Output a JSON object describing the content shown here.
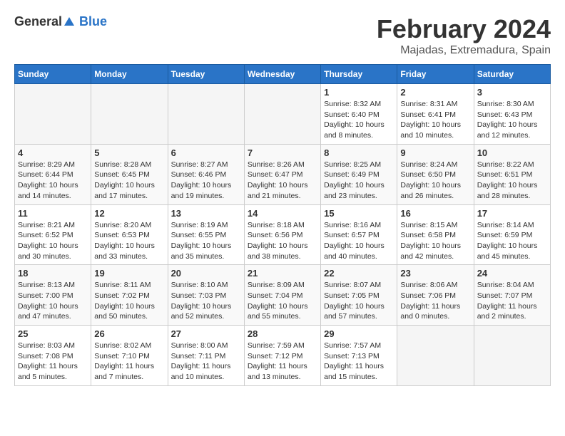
{
  "logo": {
    "general": "General",
    "blue": "Blue"
  },
  "title": {
    "month": "February 2024",
    "location": "Majadas, Extremadura, Spain"
  },
  "headers": [
    "Sunday",
    "Monday",
    "Tuesday",
    "Wednesday",
    "Thursday",
    "Friday",
    "Saturday"
  ],
  "weeks": [
    [
      {
        "day": "",
        "info": ""
      },
      {
        "day": "",
        "info": ""
      },
      {
        "day": "",
        "info": ""
      },
      {
        "day": "",
        "info": ""
      },
      {
        "day": "1",
        "info": "Sunrise: 8:32 AM\nSunset: 6:40 PM\nDaylight: 10 hours\nand 8 minutes."
      },
      {
        "day": "2",
        "info": "Sunrise: 8:31 AM\nSunset: 6:41 PM\nDaylight: 10 hours\nand 10 minutes."
      },
      {
        "day": "3",
        "info": "Sunrise: 8:30 AM\nSunset: 6:43 PM\nDaylight: 10 hours\nand 12 minutes."
      }
    ],
    [
      {
        "day": "4",
        "info": "Sunrise: 8:29 AM\nSunset: 6:44 PM\nDaylight: 10 hours\nand 14 minutes."
      },
      {
        "day": "5",
        "info": "Sunrise: 8:28 AM\nSunset: 6:45 PM\nDaylight: 10 hours\nand 17 minutes."
      },
      {
        "day": "6",
        "info": "Sunrise: 8:27 AM\nSunset: 6:46 PM\nDaylight: 10 hours\nand 19 minutes."
      },
      {
        "day": "7",
        "info": "Sunrise: 8:26 AM\nSunset: 6:47 PM\nDaylight: 10 hours\nand 21 minutes."
      },
      {
        "day": "8",
        "info": "Sunrise: 8:25 AM\nSunset: 6:49 PM\nDaylight: 10 hours\nand 23 minutes."
      },
      {
        "day": "9",
        "info": "Sunrise: 8:24 AM\nSunset: 6:50 PM\nDaylight: 10 hours\nand 26 minutes."
      },
      {
        "day": "10",
        "info": "Sunrise: 8:22 AM\nSunset: 6:51 PM\nDaylight: 10 hours\nand 28 minutes."
      }
    ],
    [
      {
        "day": "11",
        "info": "Sunrise: 8:21 AM\nSunset: 6:52 PM\nDaylight: 10 hours\nand 30 minutes."
      },
      {
        "day": "12",
        "info": "Sunrise: 8:20 AM\nSunset: 6:53 PM\nDaylight: 10 hours\nand 33 minutes."
      },
      {
        "day": "13",
        "info": "Sunrise: 8:19 AM\nSunset: 6:55 PM\nDaylight: 10 hours\nand 35 minutes."
      },
      {
        "day": "14",
        "info": "Sunrise: 8:18 AM\nSunset: 6:56 PM\nDaylight: 10 hours\nand 38 minutes."
      },
      {
        "day": "15",
        "info": "Sunrise: 8:16 AM\nSunset: 6:57 PM\nDaylight: 10 hours\nand 40 minutes."
      },
      {
        "day": "16",
        "info": "Sunrise: 8:15 AM\nSunset: 6:58 PM\nDaylight: 10 hours\nand 42 minutes."
      },
      {
        "day": "17",
        "info": "Sunrise: 8:14 AM\nSunset: 6:59 PM\nDaylight: 10 hours\nand 45 minutes."
      }
    ],
    [
      {
        "day": "18",
        "info": "Sunrise: 8:13 AM\nSunset: 7:00 PM\nDaylight: 10 hours\nand 47 minutes."
      },
      {
        "day": "19",
        "info": "Sunrise: 8:11 AM\nSunset: 7:02 PM\nDaylight: 10 hours\nand 50 minutes."
      },
      {
        "day": "20",
        "info": "Sunrise: 8:10 AM\nSunset: 7:03 PM\nDaylight: 10 hours\nand 52 minutes."
      },
      {
        "day": "21",
        "info": "Sunrise: 8:09 AM\nSunset: 7:04 PM\nDaylight: 10 hours\nand 55 minutes."
      },
      {
        "day": "22",
        "info": "Sunrise: 8:07 AM\nSunset: 7:05 PM\nDaylight: 10 hours\nand 57 minutes."
      },
      {
        "day": "23",
        "info": "Sunrise: 8:06 AM\nSunset: 7:06 PM\nDaylight: 11 hours\nand 0 minutes."
      },
      {
        "day": "24",
        "info": "Sunrise: 8:04 AM\nSunset: 7:07 PM\nDaylight: 11 hours\nand 2 minutes."
      }
    ],
    [
      {
        "day": "25",
        "info": "Sunrise: 8:03 AM\nSunset: 7:08 PM\nDaylight: 11 hours\nand 5 minutes."
      },
      {
        "day": "26",
        "info": "Sunrise: 8:02 AM\nSunset: 7:10 PM\nDaylight: 11 hours\nand 7 minutes."
      },
      {
        "day": "27",
        "info": "Sunrise: 8:00 AM\nSunset: 7:11 PM\nDaylight: 11 hours\nand 10 minutes."
      },
      {
        "day": "28",
        "info": "Sunrise: 7:59 AM\nSunset: 7:12 PM\nDaylight: 11 hours\nand 13 minutes."
      },
      {
        "day": "29",
        "info": "Sunrise: 7:57 AM\nSunset: 7:13 PM\nDaylight: 11 hours\nand 15 minutes."
      },
      {
        "day": "",
        "info": ""
      },
      {
        "day": "",
        "info": ""
      }
    ]
  ]
}
